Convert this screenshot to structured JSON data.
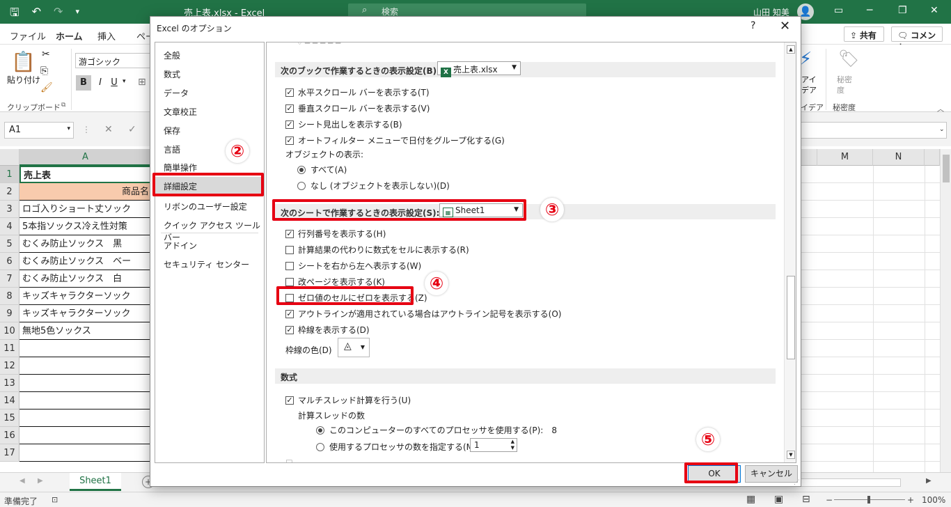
{
  "titlebar": {
    "title": "売上表.xlsx  -  Excel",
    "search": "検索",
    "user": "山田 知美"
  },
  "ribbon": {
    "tabs": [
      "ファイル",
      "ホーム",
      "挿入",
      "ペー"
    ],
    "share": "共有",
    "comment": "コメント",
    "paste": "貼り付け",
    "clipboard": "クリップボード",
    "font": "游ゴシック",
    "bold": "B",
    "italic": "I",
    "underline": "U",
    "idea_a": "アイ",
    "idea_b": "デア",
    "idea_c": "イデア",
    "sens_a": "秘密",
    "sens_b": "度",
    "sens_c": "秘密度"
  },
  "formulabar": {
    "namebox": "A1"
  },
  "grid": {
    "col_a": "A",
    "col_m": "M",
    "col_n": "N",
    "rows": [
      "1",
      "2",
      "3",
      "4",
      "5",
      "6",
      "7",
      "8",
      "9",
      "10",
      "11",
      "12",
      "13",
      "14",
      "15",
      "16",
      "17"
    ],
    "cells": [
      "売上表",
      "商品名",
      "ロゴ入りショート丈ソック",
      "5本指ソックス冷え性対策",
      "むくみ防止ソックス　黒",
      "むくみ防止ソックス　ベー",
      "むくみ防止ソックス　白",
      "キッズキャラクターソック",
      "キッズキャラクターソック",
      "無地5色ソックス"
    ]
  },
  "sheet": {
    "name": "Sheet1"
  },
  "status": {
    "ready": "準備完了",
    "zoom": "100%"
  },
  "dialog": {
    "title": "Excel のオプション",
    "help": "?",
    "close": "✕",
    "categories": [
      "全般",
      "数式",
      "データ",
      "文章校正",
      "保存",
      "言語",
      "簡単操作",
      "詳細設定",
      "リボンのユーザー設定",
      "クイック アクセス ツール バー",
      "アドイン",
      "セキュリティ センター"
    ],
    "book_section": "次のブックで作業するときの表示設定(B):",
    "book_value": "売上表.xlsx",
    "book_opts": [
      "水平スクロール バーを表示する(T)",
      "垂直スクロール バーを表示する(V)",
      "シート見出しを表示する(B)",
      "オートフィルター メニューで日付をグループ化する(G)"
    ],
    "object_label": "オブジェクトの表示:",
    "object_all": "すべて(A)",
    "object_none": "なし (オブジェクトを表示しない)(D)",
    "sheet_section": "次のシートで作業するときの表示設定(S):",
    "sheet_value": "Sheet1",
    "sheet_opts": [
      "行列番号を表示する(H)",
      "計算結果の代わりに数式をセルに表示する(R)",
      "シートを右から左へ表示する(W)",
      "改ページを表示する(K)",
      "ゼロ値のセルにゼロを表示する(Z)",
      "アウトラインが適用されている場合はアウトライン記号を表示する(O)",
      "枠線を表示する(D)"
    ],
    "sheet_checked": [
      true,
      false,
      false,
      false,
      false,
      true,
      true
    ],
    "grid_color_label": "枠線の色(D)",
    "formula_section": "数式",
    "multithread": "マルチスレッド計算を行う(U)",
    "threads_label": "計算スレッドの数",
    "threads_all": "このコンピューターのすべてのプロセッサを使用する(P):",
    "threads_count": "8",
    "threads_manual": "使用するプロセッサの数を指定する(M):",
    "threads_manual_value": "1",
    "ok": "OK",
    "cancel": "キャンセル"
  },
  "annotations": [
    "②",
    "③",
    "④",
    "⑤"
  ],
  "colors": {
    "excel_green": "#217346",
    "annotation_red": "#e60012"
  }
}
